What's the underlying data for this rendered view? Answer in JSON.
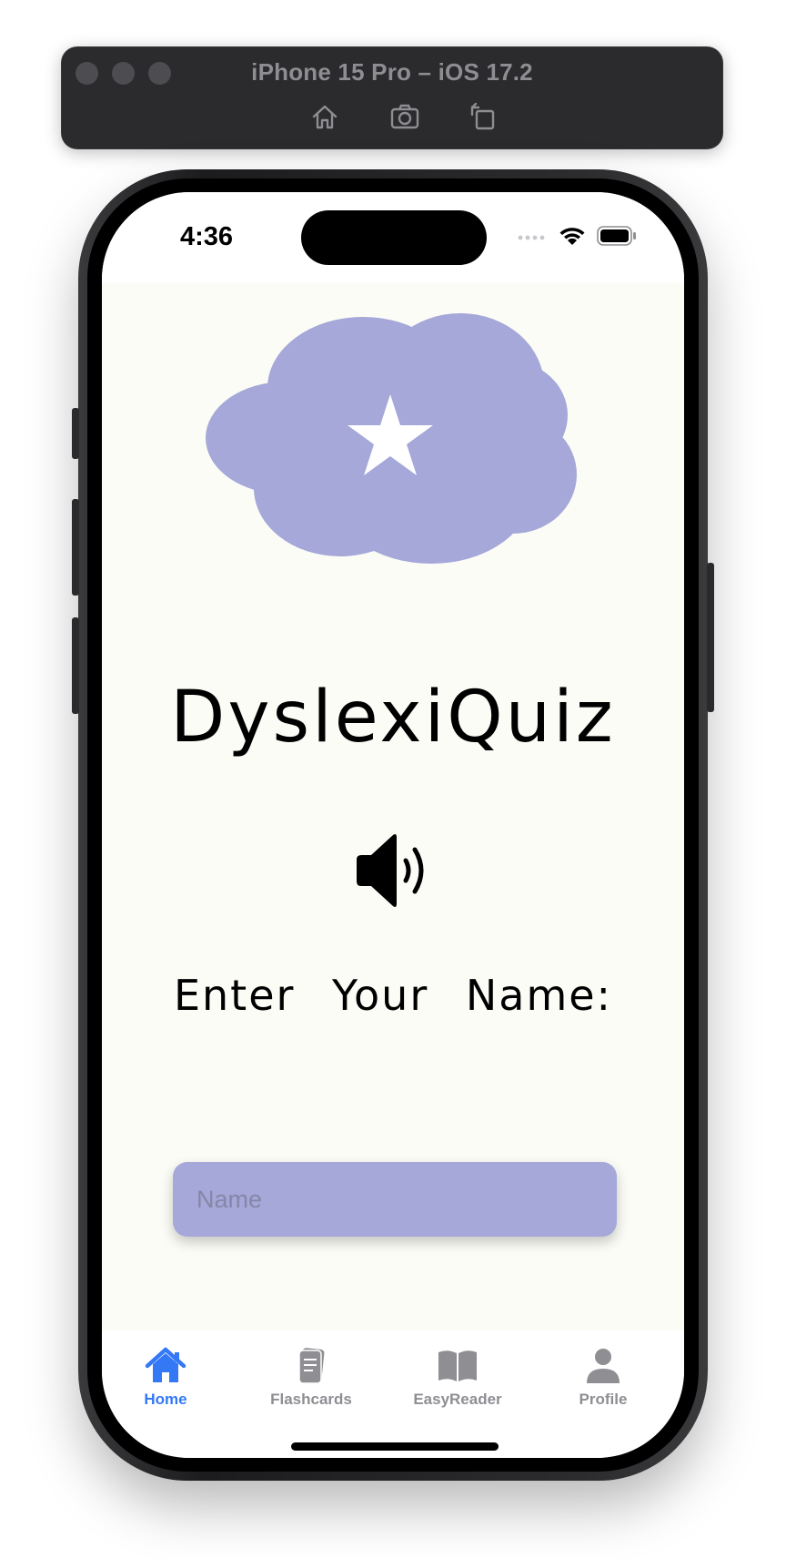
{
  "simulator": {
    "title": "iPhone 15 Pro – iOS 17.2",
    "buttons": [
      "home-icon",
      "screenshot-icon",
      "rotate-icon"
    ]
  },
  "status_bar": {
    "time": "4:36",
    "icons": [
      "signal-icon",
      "wifi-icon",
      "battery-icon"
    ]
  },
  "app": {
    "title": "DyslexiQuiz",
    "prompt": "Enter Your Name:",
    "name_input": {
      "placeholder": "Name",
      "value": ""
    },
    "logo": "cloud-star-icon",
    "speaker": "speaker-icon"
  },
  "colors": {
    "accent": "#3478f6",
    "cloud": "#a5a8d8",
    "input_bg": "#a5a8d8",
    "background": "#fcfcf7",
    "tab_inactive": "#8e8e93"
  },
  "tab_bar": {
    "items": [
      {
        "label": "Home",
        "icon": "house-icon",
        "active": true
      },
      {
        "label": "Flashcards",
        "icon": "cards-icon",
        "active": false
      },
      {
        "label": "EasyReader",
        "icon": "book-icon",
        "active": false
      },
      {
        "label": "Profile",
        "icon": "person-icon",
        "active": false
      }
    ]
  }
}
